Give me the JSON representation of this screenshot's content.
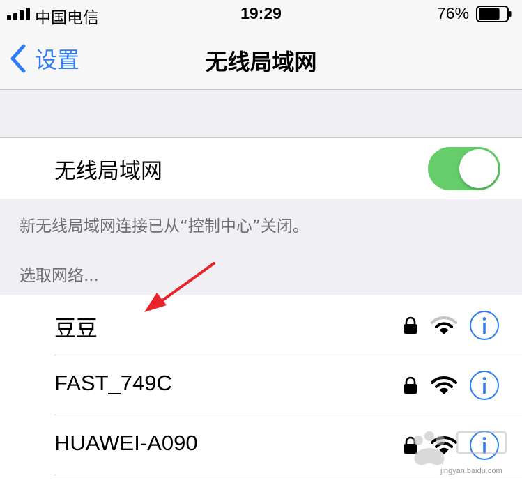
{
  "status_bar": {
    "carrier": "中国电信",
    "time": "19:29",
    "battery_percent": "76%",
    "battery_level": 0.76,
    "signal_bars": 4
  },
  "nav": {
    "back_label": "设置",
    "title": "无线局域网"
  },
  "wifi_toggle": {
    "label": "无线局域网",
    "on": true,
    "on_color": "#65cd6a"
  },
  "footnote": "新无线局域网连接已从“控制中心”关闭。",
  "section_header": "选取网络...",
  "networks": [
    {
      "name": "豆豆",
      "secured": true,
      "icon": "wifi-icon",
      "signal_level": 2
    },
    {
      "name": "FAST_749C",
      "secured": true,
      "icon": "wifi-icon",
      "signal_level": 3
    },
    {
      "name": "HUAWEI-A090",
      "secured": true,
      "icon": "wifi-icon",
      "signal_level": 3
    }
  ],
  "accent_color": "#2f7df6",
  "watermark": {
    "site": "jingyan.baidu.com"
  }
}
